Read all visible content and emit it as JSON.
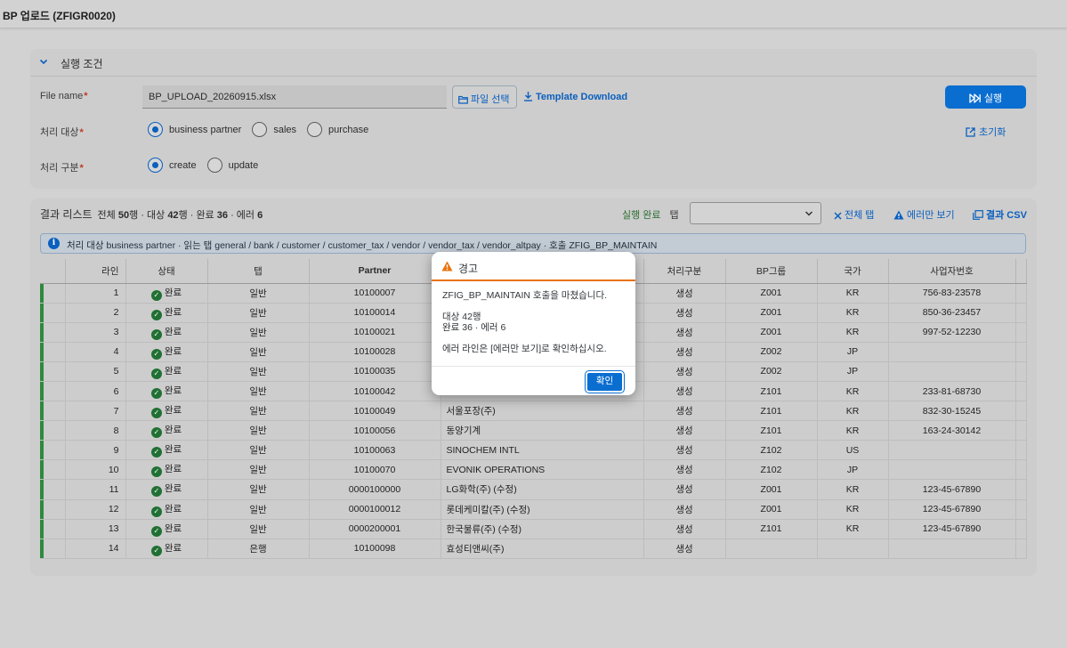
{
  "app": {
    "title": "BP 업로드 (ZFIGR0020)"
  },
  "conditions": {
    "header": "실행 조건",
    "file_label": "File name",
    "file_value": "BP_UPLOAD_20260915.xlsx",
    "file_button": "파일 선택",
    "template_link": "Template Download",
    "run_button": "실행",
    "reset_link": "초기화",
    "target_label": "처리 대상",
    "target_options": [
      "business partner",
      "sales",
      "purchase"
    ],
    "target_selected": "business partner",
    "mode_label": "처리 구분",
    "mode_options": [
      "create",
      "update"
    ],
    "mode_selected": "create",
    "required_mark": "*"
  },
  "results": {
    "title": "결과 리스트",
    "summary_prefix": "전체",
    "total": "50",
    "summary_row_unit": "행 · 대상",
    "target_count": "42",
    "summary_done": "행 · 완료",
    "done_count": "36",
    "summary_error": "· 에러",
    "error_count": "6",
    "status_label": "실행 완료",
    "tab_label": "탭",
    "tab_select_value": "",
    "all_tabs_link": "전체 탭",
    "errors_only_link": "에러만 보기",
    "csv_link": "결과 CSV",
    "info_text": "처리 대상 business partner · 읽는 탭 general / bank / customer / customer_tax / vendor / vendor_tax / vendor_altpay · 호출 ZFIG_BP_MAINTAIN",
    "columns": [
      "라인",
      "상태",
      "탭",
      "Partner",
      "",
      "처리구분",
      "BP그룹",
      "국가",
      "사업자번호"
    ],
    "rows": [
      {
        "line": "1",
        "status": "완료",
        "tab": "일반",
        "partner": "10100007",
        "name": "",
        "action": "생성",
        "group": "Z001",
        "country": "KR",
        "bizno": "756-83-23578"
      },
      {
        "line": "2",
        "status": "완료",
        "tab": "일반",
        "partner": "10100014",
        "name": "",
        "action": "생성",
        "group": "Z001",
        "country": "KR",
        "bizno": "850-36-23457"
      },
      {
        "line": "3",
        "status": "완료",
        "tab": "일반",
        "partner": "10100021",
        "name": "",
        "action": "생성",
        "group": "Z001",
        "country": "KR",
        "bizno": "997-52-12230"
      },
      {
        "line": "4",
        "status": "완료",
        "tab": "일반",
        "partner": "10100028",
        "name": "",
        "action": "생성",
        "group": "Z002",
        "country": "JP",
        "bizno": ""
      },
      {
        "line": "5",
        "status": "완료",
        "tab": "일반",
        "partner": "10100035",
        "name": "",
        "action": "생성",
        "group": "Z002",
        "country": "JP",
        "bizno": ""
      },
      {
        "line": "6",
        "status": "완료",
        "tab": "일반",
        "partner": "10100042",
        "name": "",
        "action": "생성",
        "group": "Z101",
        "country": "KR",
        "bizno": "233-81-68730"
      },
      {
        "line": "7",
        "status": "완료",
        "tab": "일반",
        "partner": "10100049",
        "name": "서울포장(주)",
        "action": "생성",
        "group": "Z101",
        "country": "KR",
        "bizno": "832-30-15245"
      },
      {
        "line": "8",
        "status": "완료",
        "tab": "일반",
        "partner": "10100056",
        "name": "동양기계",
        "action": "생성",
        "group": "Z101",
        "country": "KR",
        "bizno": "163-24-30142"
      },
      {
        "line": "9",
        "status": "완료",
        "tab": "일반",
        "partner": "10100063",
        "name": "SINOCHEM INTL",
        "action": "생성",
        "group": "Z102",
        "country": "US",
        "bizno": ""
      },
      {
        "line": "10",
        "status": "완료",
        "tab": "일반",
        "partner": "10100070",
        "name": "EVONIK OPERATIONS",
        "action": "생성",
        "group": "Z102",
        "country": "JP",
        "bizno": ""
      },
      {
        "line": "11",
        "status": "완료",
        "tab": "일반",
        "partner": "0000100000",
        "name": "LG화학(주) (수정)",
        "action": "생성",
        "group": "Z001",
        "country": "KR",
        "bizno": "123-45-67890"
      },
      {
        "line": "12",
        "status": "완료",
        "tab": "일반",
        "partner": "0000100012",
        "name": "롯데케미칼(주) (수정)",
        "action": "생성",
        "group": "Z001",
        "country": "KR",
        "bizno": "123-45-67890"
      },
      {
        "line": "13",
        "status": "완료",
        "tab": "일반",
        "partner": "0000200001",
        "name": "한국물류(주) (수정)",
        "action": "생성",
        "group": "Z101",
        "country": "KR",
        "bizno": "123-45-67890"
      },
      {
        "line": "14",
        "status": "완료",
        "tab": "은행",
        "partner": "10100098",
        "name": "효성티앤씨(주)",
        "action": "생성",
        "group": "",
        "country": "",
        "bizno": ""
      }
    ]
  },
  "dialog": {
    "title": "경고",
    "message": "ZFIG_BP_MAINTAIN 호출을 마쳤습니다.",
    "line_target": "대상 42행",
    "line_result": "완료 36 · 에러 6",
    "hint": "에러 라인은 [에러만 보기]로 확인하십시오.",
    "ok_button": "확인"
  },
  "colors": {
    "accent": "#0a6ed1",
    "success": "#207033",
    "warning": "#e9730c"
  }
}
